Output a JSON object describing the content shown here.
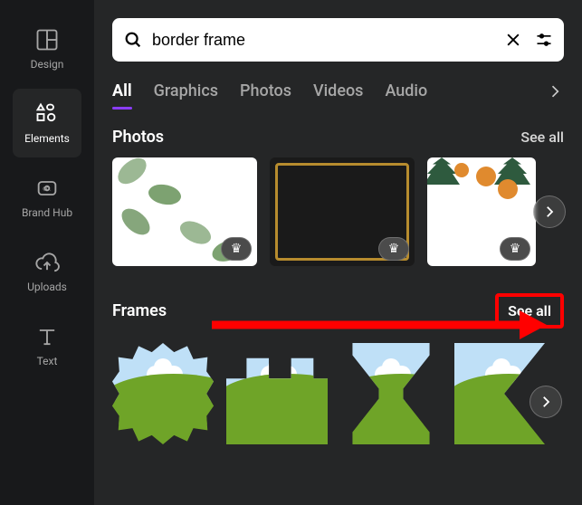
{
  "sidebar": {
    "items": [
      {
        "label": "Design",
        "name": "design",
        "icon": "layout"
      },
      {
        "label": "Elements",
        "name": "elements",
        "icon": "shapes",
        "active": true
      },
      {
        "label": "Brand Hub",
        "name": "brand-hub",
        "icon": "badge"
      },
      {
        "label": "Uploads",
        "name": "uploads",
        "icon": "cloud-up"
      },
      {
        "label": "Text",
        "name": "text",
        "icon": "text"
      }
    ]
  },
  "search": {
    "value": "border frame"
  },
  "tabs": [
    "All",
    "Graphics",
    "Photos",
    "Videos",
    "Audio"
  ],
  "tab_active_index": 0,
  "sections": {
    "photos": {
      "title": "Photos",
      "see_all": "See all"
    },
    "frames": {
      "title": "Frames",
      "see_all": "See all"
    }
  },
  "photo_premium_icon": "♛"
}
